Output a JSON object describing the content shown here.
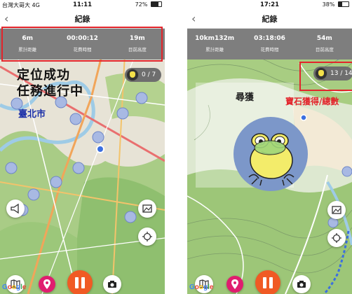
{
  "left": {
    "status": {
      "carrier": "台灣大哥大  4G",
      "time": "11:11",
      "battery": "72%",
      "battery_level": 0.72
    },
    "nav": {
      "back": "‹",
      "title": "紀錄"
    },
    "stats": [
      {
        "value": "6m",
        "label": "累計距離"
      },
      {
        "value": "00:00:12",
        "label": "花費時間"
      },
      {
        "value": "19m",
        "label": "目前高度"
      }
    ],
    "annotation": {
      "line1": "定位成功",
      "line2": "任務進行中"
    },
    "city_label": "臺北市",
    "counter": "0 / 7",
    "google": "Google"
  },
  "right": {
    "status": {
      "time": "17:21",
      "battery": "38%",
      "battery_level": 0.38
    },
    "nav": {
      "back": "‹",
      "title": "紀錄"
    },
    "stats": [
      {
        "value": "10km132m",
        "label": "累計距離"
      },
      {
        "value": "03:18:06",
        "label": "花費時間"
      },
      {
        "value": "54m",
        "label": "目前高度"
      }
    ],
    "counter": "13 / 14",
    "modal_title": "尋獲",
    "annotation": "寶石獲得/總數",
    "google": "Google"
  },
  "colors": {
    "accent": "#f05a24",
    "pin": "#e01d6f",
    "highlight": "#e3242b",
    "stats_bar": "#7e7e7e"
  }
}
